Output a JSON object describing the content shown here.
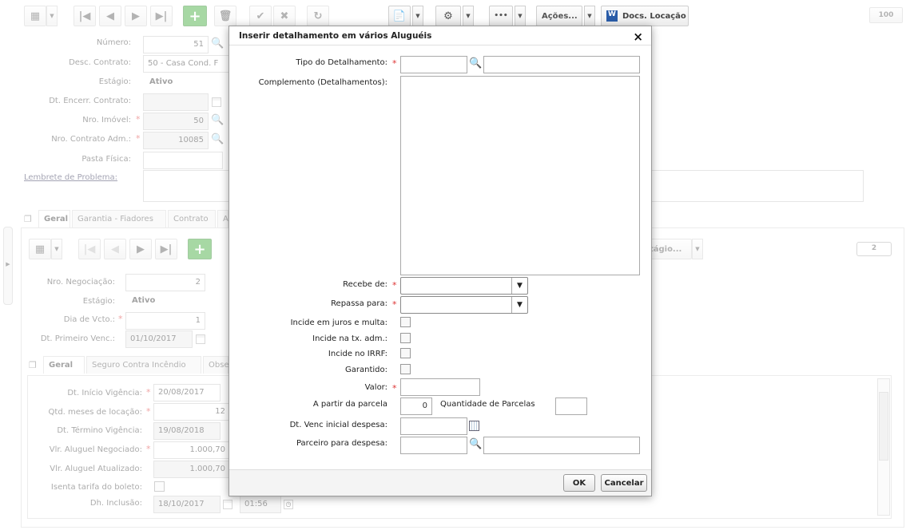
{
  "toolbar": {
    "acoes": "Ações...",
    "docs": "Docs. Locação",
    "badge": "100",
    "add": "+",
    "more": "•••"
  },
  "form": {
    "numero_label": "Número:",
    "numero": "51",
    "desc_label": "Desc. Contrato:",
    "desc": "50 - Casa Cond. F",
    "estagio_label": "Estágio:",
    "estagio": "Ativo",
    "encerr_label": "Dt. Encerr. Contrato:",
    "imovel_label": "Nro. Imóvel:",
    "imovel": "50",
    "contrato_adm_label": "Nro. Contrato Adm.:",
    "contrato_adm": "10085",
    "pasta_label": "Pasta Física:",
    "lembrete_label": "Lembrete de Problema:"
  },
  "tabs": [
    "Geral",
    "Garantia - Fiadores",
    "Contrato",
    "A"
  ],
  "neg": {
    "badge": "2",
    "estagio_btn": "stágio...",
    "nro_label": "Nro. Negociação:",
    "nro": "2",
    "estagio_label": "Estágio:",
    "estagio": "Ativo",
    "dia_label": "Dia de Vcto.:",
    "dia": "1",
    "primeiro_label": "Dt. Primeiro Venc.:",
    "primeiro": "01/10/2017"
  },
  "subtabs": [
    "Geral",
    "Seguro Contra Incêndio",
    "Obse"
  ],
  "vig": {
    "inicio_label": "Dt. Início Vigência:",
    "inicio": "20/08/2017",
    "meses_label": "Qtd. meses de locação:",
    "meses": "12",
    "termino_label": "Dt. Término Vigência:",
    "termino": "19/08/2018",
    "neg_label": "Vlr. Aluguel Negociado:",
    "neg": "1.000,70",
    "atu_label": "Vlr. Aluguel Atualizado:",
    "atu": "1.000,70",
    "isenta_label": "Isenta tarifa do boleto:",
    "inclusao_label": "Dh. Inclusão:",
    "inclusao_data": "18/10/2017",
    "inclusao_hora": "01:56"
  },
  "modal": {
    "title": "Inserir detalhamento em vários Aluguéis",
    "close": "×",
    "tipo": "Tipo do Detalhamento:",
    "complemento": "Complemento (Detalhamentos):",
    "recebe": "Recebe de:",
    "repassa": "Repassa para:",
    "juros": "Incide em juros e multa:",
    "txadm": "Incide na tx. adm.:",
    "irrf": "Incide no IRRF:",
    "garantido": "Garantido:",
    "valor": "Valor:",
    "parcela": "A partir da parcela",
    "parcela_val": "0",
    "qtd": "Quantidade de Parcelas",
    "dtvenc": "Dt. Venc inicial despesa:",
    "parceiro": "Parceiro para despesa:",
    "ok": "OK",
    "cancel": "Cancelar"
  }
}
